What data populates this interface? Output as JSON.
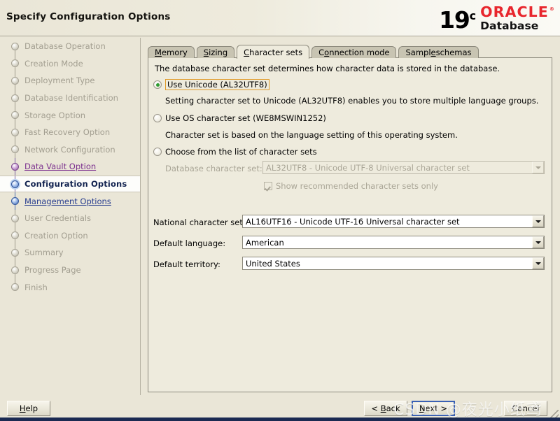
{
  "window": {
    "title": "Specify Configuration Options"
  },
  "brand": {
    "version": "19",
    "version_sup": "c",
    "oracle": "ORACLE",
    "product": "Database"
  },
  "sidebar": {
    "items": [
      {
        "label": "Database Operation",
        "state": "disabled"
      },
      {
        "label": "Creation Mode",
        "state": "disabled"
      },
      {
        "label": "Deployment Type",
        "state": "disabled"
      },
      {
        "label": "Database Identification",
        "state": "disabled"
      },
      {
        "label": "Storage Option",
        "state": "disabled"
      },
      {
        "label": "Fast Recovery Option",
        "state": "disabled"
      },
      {
        "label": "Network Configuration",
        "state": "disabled"
      },
      {
        "label": "Data Vault Option",
        "state": "link-purple"
      },
      {
        "label": "Configuration Options",
        "state": "current"
      },
      {
        "label": "Management Options",
        "state": "link-blue"
      },
      {
        "label": "User Credentials",
        "state": "disabled"
      },
      {
        "label": "Creation Option",
        "state": "disabled"
      },
      {
        "label": "Summary",
        "state": "disabled"
      },
      {
        "label": "Progress Page",
        "state": "disabled"
      },
      {
        "label": "Finish",
        "state": "disabled"
      }
    ]
  },
  "tabs": [
    {
      "label": "Memory",
      "mnemonic": "M",
      "active": false
    },
    {
      "label": "Sizing",
      "mnemonic": "S",
      "active": false
    },
    {
      "label": "Character sets",
      "mnemonic": "C",
      "active": true
    },
    {
      "label": "Connection mode",
      "mnemonic": "C",
      "active": false
    },
    {
      "label": "Sample schemas",
      "mnemonic": "e",
      "active": false
    }
  ],
  "main": {
    "intro": "The database character set determines how character data is stored in the database.",
    "options": [
      {
        "label": "Use Unicode (AL32UTF8)",
        "selected": true,
        "focused": true,
        "description": "Setting character set to Unicode (AL32UTF8) enables you to store multiple language groups."
      },
      {
        "label": "Use OS character set (WE8MSWIN1252)",
        "selected": false,
        "focused": false,
        "description": "Character set is based on the language setting of this operating system."
      },
      {
        "label": "Choose from the list of character sets",
        "selected": false,
        "focused": false,
        "description": ""
      }
    ],
    "db_charset": {
      "label": "Database character set:",
      "value": "AL32UTF8 - Unicode UTF-8 Universal character set",
      "enabled": false
    },
    "show_recommended": {
      "label": "Show recommended character sets only",
      "checked": true,
      "enabled": false
    },
    "national_charset": {
      "label": "National character set:",
      "value": "AL16UTF16 - Unicode UTF-16 Universal character set"
    },
    "default_language": {
      "label": "Default language:",
      "value": "American"
    },
    "default_territory": {
      "label": "Default territory:",
      "value": "United States"
    }
  },
  "buttons": {
    "help": "Help",
    "back": "< Back",
    "next": "Next >",
    "cancel": "Cancel"
  },
  "watermark": "CSDN @夜光小纸鸢",
  "colors": {
    "accent_blue": "#2a3f8f",
    "link_purple": "#7b2f8e",
    "oracle_red": "#e8262d",
    "panel_bg": "#eeebdd",
    "window_bg": "#eae6d7",
    "focus_orange": "#e09a2a"
  }
}
